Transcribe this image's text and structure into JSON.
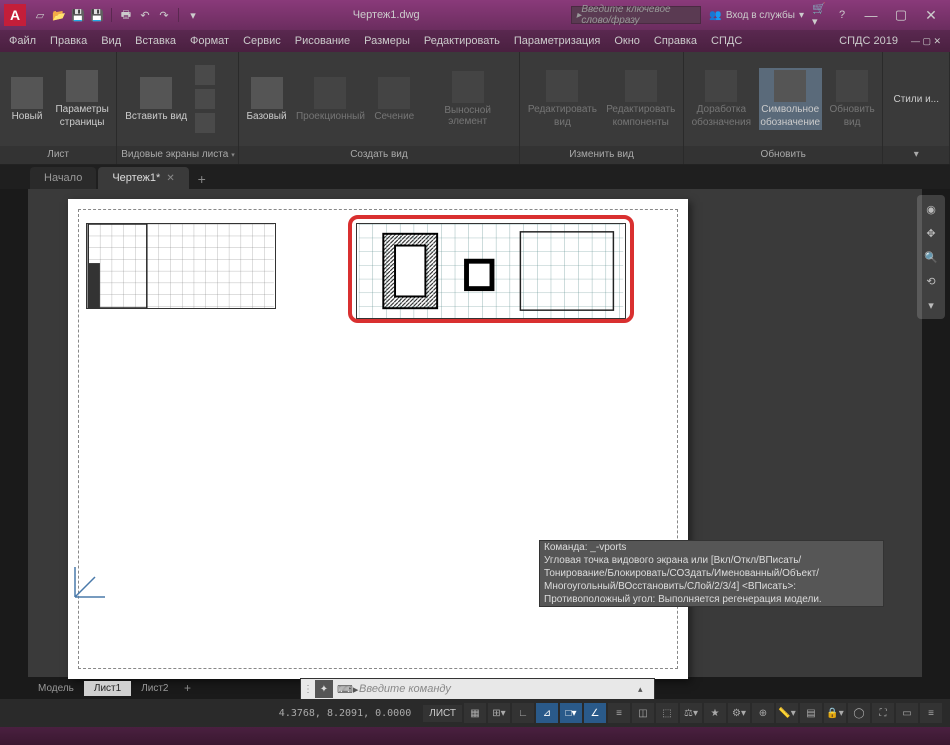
{
  "app_icon_letter": "A",
  "title": "Чертеж1.dwg",
  "search_placeholder": "Введите ключевое слово/фразу",
  "login_label": "Вход в службы",
  "menu": [
    "Файл",
    "Правка",
    "Вид",
    "Вставка",
    "Формат",
    "Сервис",
    "Рисование",
    "Размеры",
    "Редактировать",
    "Параметризация",
    "Окно",
    "Справка",
    "СПДС"
  ],
  "menu_right": "СПДС 2019",
  "ribbon": {
    "panels": [
      {
        "title": "Лист",
        "drop": false,
        "items": [
          {
            "label": "Новый",
            "dim": false
          },
          {
            "label": "Параметры\nстраницы",
            "dim": false
          }
        ]
      },
      {
        "title": "Видовые экраны листа",
        "drop": true,
        "items": [
          {
            "label": "Вставить вид",
            "dim": false
          }
        ]
      },
      {
        "title": "Создать вид",
        "drop": false,
        "items": [
          {
            "label": "Базовый",
            "dim": false
          },
          {
            "label": "Проекционный",
            "dim": true
          },
          {
            "label": "Сечение",
            "dim": true
          },
          {
            "label": "Выносной элемент",
            "dim": true
          }
        ]
      },
      {
        "title": "Изменить вид",
        "drop": false,
        "items": [
          {
            "label": "Редактировать\nвид",
            "dim": true
          },
          {
            "label": "Редактировать\nкомпоненты",
            "dim": true
          }
        ]
      },
      {
        "title": "Обновить",
        "drop": false,
        "items": [
          {
            "label": "Доработка\nобозначения",
            "dim": true
          },
          {
            "label": "Символьное\nобозначение",
            "dim": false,
            "active": true
          },
          {
            "label": "Обновить\nвид",
            "dim": true
          }
        ]
      }
    ],
    "styles": "Стили и..."
  },
  "filetabs": [
    {
      "label": "Начало",
      "active": false,
      "closable": false
    },
    {
      "label": "Чертеж1*",
      "active": true,
      "closable": true
    }
  ],
  "cmd_history": [
    "Команда: _-vports",
    "Угловая точка видового экрана или [Вкл/Откл/ВПисать/",
    "Тонирование/Блокировать/СОЗдать/Именованный/Объект/",
    "Многоугольный/ВОсстановить/СЛой/2/3/4] <ВПисать>:",
    "Противоположный угол: Выполняется регенерация модели."
  ],
  "cmd_placeholder": "Введите команду",
  "layout_tabs": [
    {
      "label": "Модель",
      "active": false
    },
    {
      "label": "Лист1",
      "active": true
    },
    {
      "label": "Лист2",
      "active": false
    }
  ],
  "status": {
    "coords": "4.3768, 8.2091, 0.0000",
    "space": "ЛИСТ"
  }
}
